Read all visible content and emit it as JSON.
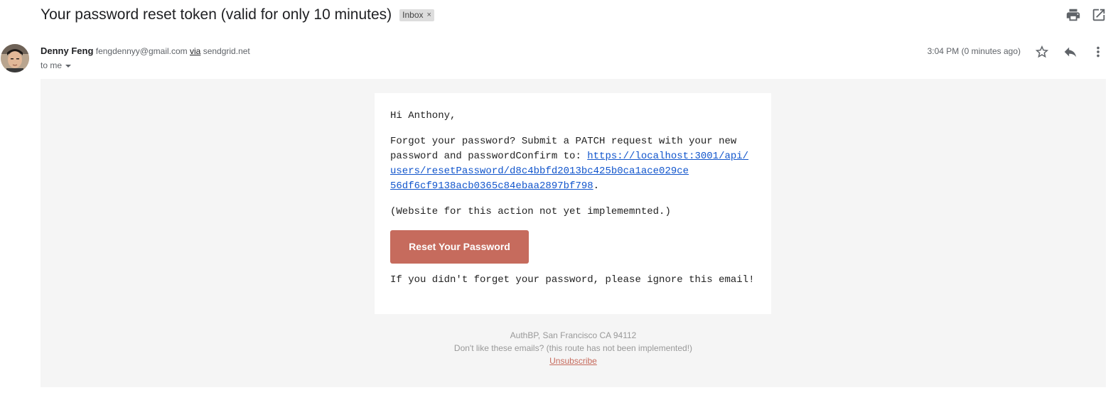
{
  "email": {
    "subject": "Your password reset token (valid for only 10 minutes)",
    "label": "Inbox",
    "label_remove": "×",
    "sender": {
      "name": "Denny Feng",
      "email": "fengdennyy@gmail.com",
      "via_label": "via",
      "via_domain": "sendgrid.net"
    },
    "recipient": "to me",
    "timestamp": "3:04 PM (0 minutes ago)"
  },
  "icons": {
    "print": "print-icon",
    "popout": "open-in-new-window-icon",
    "star": "star-icon",
    "reply": "reply-icon",
    "more": "more-vertical-icon",
    "avatar": "sender-avatar"
  },
  "body": {
    "greeting": "Hi Anthony,",
    "intro": "Forgot your password? Submit a PATCH request with your new password and passwordConfirm to: ",
    "link_line1": "https://localhost:3001/api/",
    "link_line2": "users/resetPassword/d8c4bbfd2013bc425b0ca1ace029ce",
    "link_line3": "56df6cf9138acb0365c84ebaa2897bf798",
    "link_end": ".",
    "note": "(Website for this action not yet implememnted.)",
    "button_label": "Reset Your Password",
    "closing": "If you didn't forget your password, please ignore this email!"
  },
  "footer": {
    "address": "AuthBP, San Francisco CA 94112",
    "disclaimer": "Don't like these emails? (this route has not been implemented!)",
    "unsubscribe": "Unsubscribe"
  },
  "colors": {
    "button": "#c66b5d",
    "link": "#1155cc",
    "body_bg": "#f5f5f5"
  }
}
